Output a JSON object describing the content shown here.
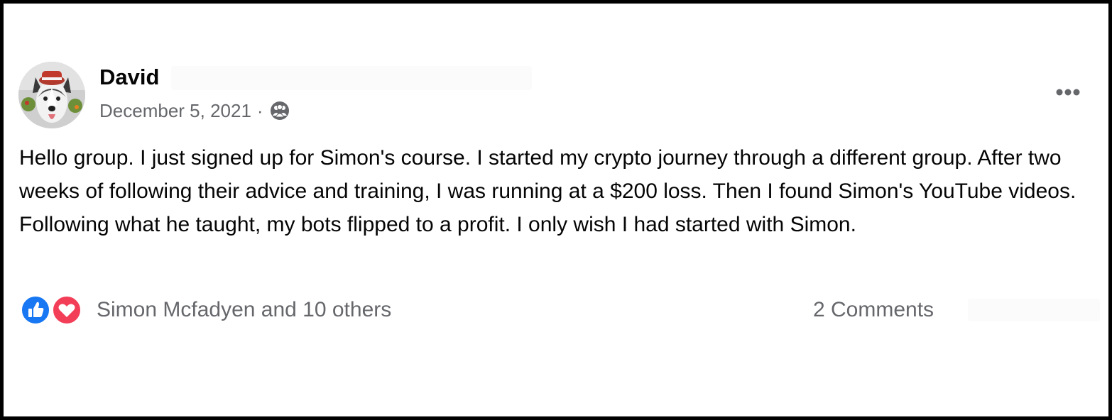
{
  "post": {
    "author": "David",
    "date": "December 5, 2021",
    "separator": "·",
    "audience_icon": "group-members-icon",
    "more_icon": "more-options-icon",
    "text": "Hello group. I just signed up for Simon's course. I started my crypto journey through a different group. After two weeks of following their advice and training, I was running at a $200 loss. Then I found Simon's YouTube videos. Following what he taught, my bots flipped to a profit. I only wish I had started with Simon."
  },
  "footer": {
    "reactions_text": "Simon Mcfadyen and 10 others",
    "reaction_icons": [
      "like-icon",
      "love-icon"
    ],
    "comments": "2 Comments"
  },
  "colors": {
    "like": "#1877f2",
    "love": "#f33e58",
    "text_primary": "#050505",
    "text_secondary": "#65676b",
    "border": "#000000"
  }
}
